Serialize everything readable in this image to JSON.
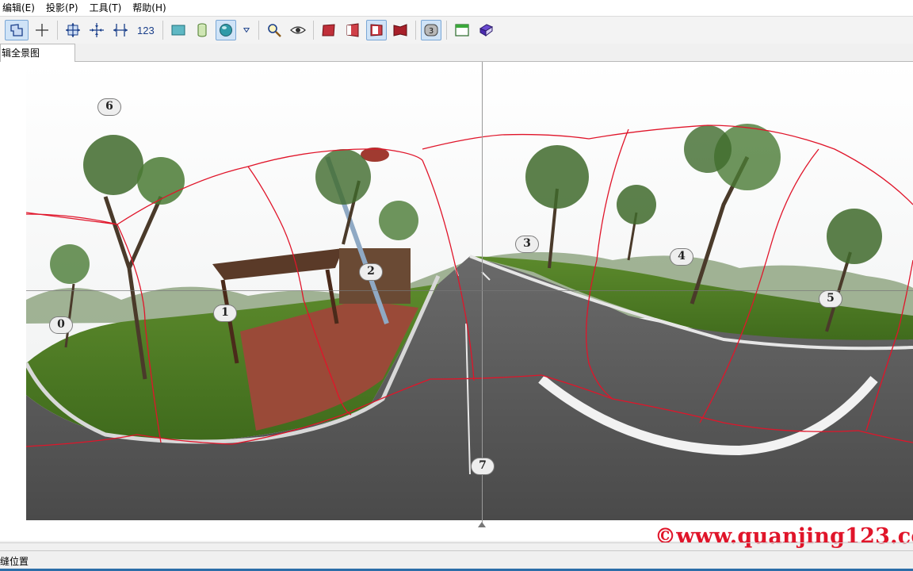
{
  "menu": {
    "items": [
      {
        "label": "编辑(E)"
      },
      {
        "label": "投影(P)"
      },
      {
        "label": "工具(T)"
      },
      {
        "label": "帮助(H)"
      }
    ]
  },
  "toolbar": {
    "numbers_button": "123",
    "colors": {
      "active_bg": "#cfe3f7",
      "icon_blue": "#1a3f8a",
      "icon_red": "#b3202a"
    }
  },
  "tab": {
    "label": "辑全景图"
  },
  "panorama": {
    "markers": [
      "0",
      "1",
      "2",
      "3",
      "4",
      "5",
      "6",
      "7"
    ],
    "seam_color": "#e0152a"
  },
  "watermark": {
    "text": "©www.quanjing123.co"
  },
  "status": {
    "text": "缝位置"
  }
}
